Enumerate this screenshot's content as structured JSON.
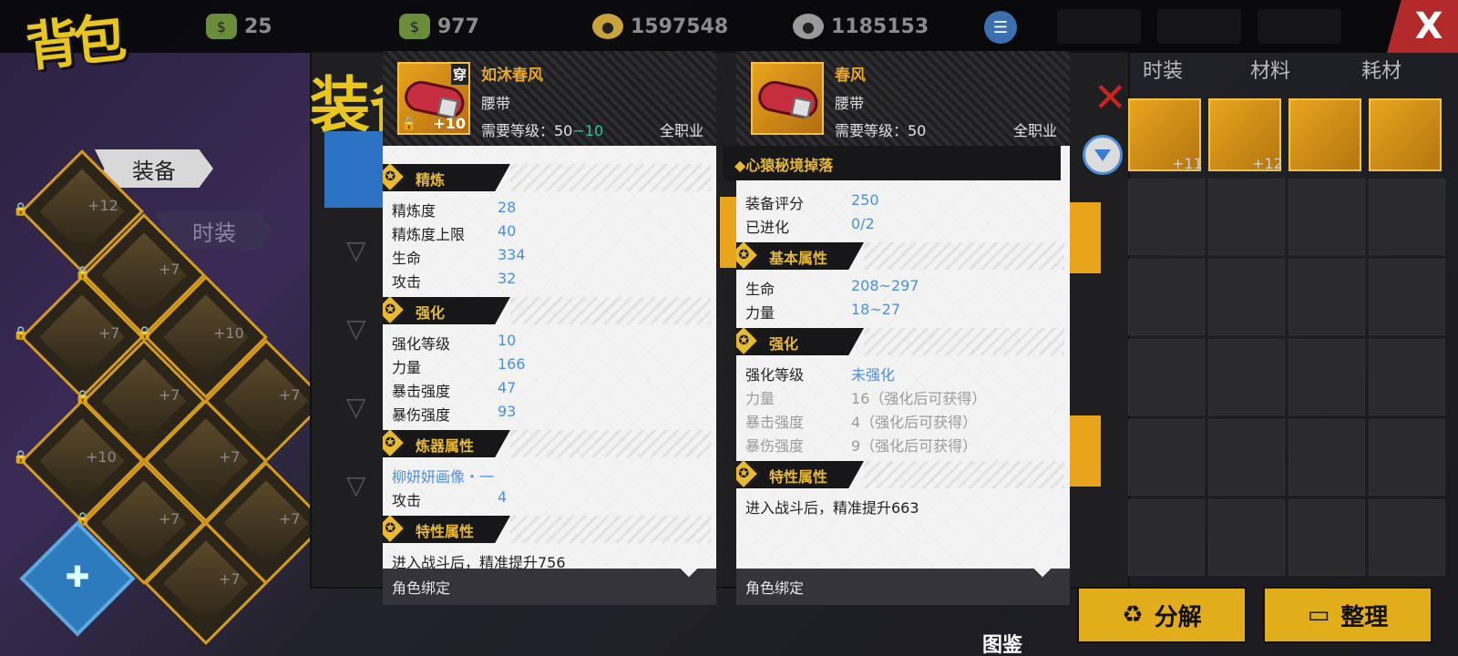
{
  "topbar": {
    "title": "背包",
    "currencies": [
      {
        "icon": "cash-icon",
        "value": "25"
      },
      {
        "icon": "cash-stack-icon",
        "value": "977"
      },
      {
        "icon": "gold-coin-icon",
        "value": "1597548"
      },
      {
        "icon": "silver-coin-icon",
        "value": "1185153"
      }
    ],
    "close_label": "X"
  },
  "left": {
    "tabs": [
      "装备",
      "时装"
    ],
    "diamond_levels": [
      "+12",
      "+7",
      "+7",
      "+10",
      "+7",
      "+7",
      "+10",
      "+7",
      "+7",
      "+7",
      "+7",
      "+7"
    ]
  },
  "middle": {
    "heading": "装备",
    "shortcut_label": "图鉴"
  },
  "right": {
    "tabs": [
      "时装",
      "材料",
      "耗材"
    ],
    "weapon_levels": [
      "+11",
      "+12"
    ],
    "buttons": {
      "decompose": "分解",
      "sort": "整理"
    }
  },
  "card_equipped": {
    "wear_tag": "穿",
    "plus_level": "+10",
    "name": "如沐春风",
    "type": "腰带",
    "req_prefix": "需要等级：50",
    "req_minus": "−10",
    "class": "全职业",
    "sections": {
      "refine": {
        "title": "精炼",
        "rows": [
          {
            "k": "精炼度",
            "v": "28"
          },
          {
            "k": "精炼度上限",
            "v": "40"
          },
          {
            "k": "生命",
            "v": "334"
          },
          {
            "k": "攻击",
            "v": "32"
          }
        ]
      },
      "enhance": {
        "title": "强化",
        "rows": [
          {
            "k": "强化等级",
            "v": "10"
          },
          {
            "k": "力量",
            "v": "166"
          },
          {
            "k": "暴击强度",
            "v": "47"
          },
          {
            "k": "暴伤强度",
            "v": "93"
          }
        ]
      },
      "artifact": {
        "title": "炼器属性",
        "link": "柳妍妍画像・一",
        "rows": [
          {
            "k": "攻击",
            "v": "4"
          }
        ]
      },
      "trait": {
        "title": "特性属性",
        "text": "进入战斗后，精准提升756"
      }
    },
    "footer": "角色绑定"
  },
  "card_compare": {
    "name": "春风",
    "type": "腰带",
    "req": "需要等级：50",
    "class": "全职业",
    "drop_source": "◆心猿秘境掉落",
    "rows_top": [
      {
        "k": "装备评分",
        "v": "250"
      },
      {
        "k": "已进化",
        "v": "0/2"
      }
    ],
    "sections": {
      "base": {
        "title": "基本属性",
        "rows": [
          {
            "k": "生命",
            "v": "208~297"
          },
          {
            "k": "力量",
            "v": "18~27"
          }
        ]
      },
      "enhance": {
        "title": "强化",
        "level_k": "强化等级",
        "level_v": "未强化",
        "rows": [
          {
            "k": "力量",
            "v": "16（强化后可获得）"
          },
          {
            "k": "暴击强度",
            "v": "4（强化后可获得）"
          },
          {
            "k": "暴伤强度",
            "v": "9（强化后可获得）"
          }
        ]
      },
      "trait": {
        "title": "特性属性",
        "text": "进入战斗后，精准提升663"
      }
    },
    "footer": "角色绑定"
  },
  "colors": {
    "accent_gold": "#e7b935",
    "value_blue": "#4a8fe0",
    "req_minus_green": "#2ec3a0",
    "close_red": "#b22a2a"
  }
}
